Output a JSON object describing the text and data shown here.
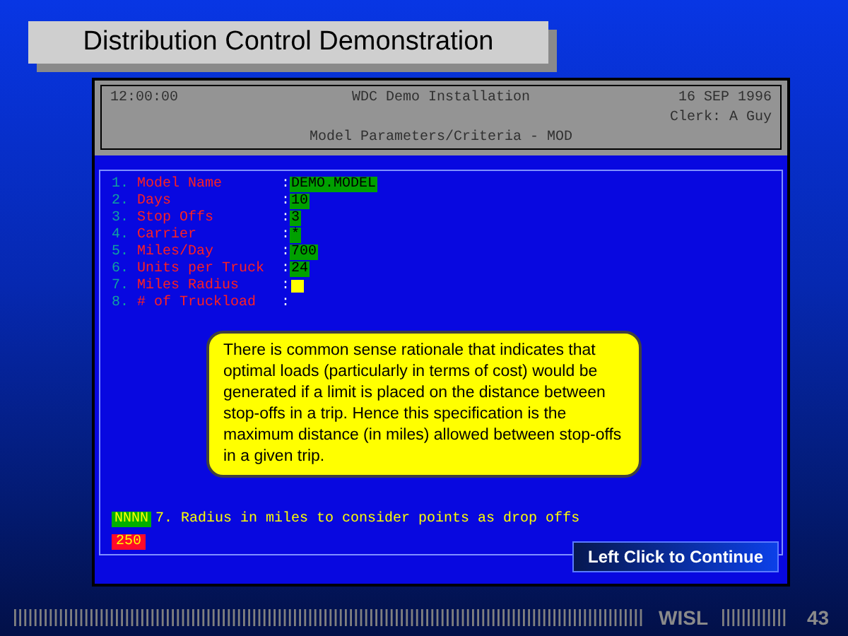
{
  "title": "Distribution Control Demonstration",
  "terminal": {
    "time": "12:00:00",
    "system": "WDC Demo Installation",
    "date": "16 SEP 1996",
    "clerk": "Clerk: A Guy",
    "screen": "Model Parameters/Criteria - MOD"
  },
  "fields": [
    {
      "number": "1.",
      "label": "Model Name",
      "separator": ":",
      "value": "DEMO.MODEL",
      "kind": "value"
    },
    {
      "number": "2.",
      "label": "Days",
      "separator": ":",
      "value": "10",
      "kind": "value"
    },
    {
      "number": "3.",
      "label": "Stop Offs",
      "separator": ":",
      "value": "3",
      "kind": "value"
    },
    {
      "number": "4.",
      "label": "Carrier",
      "separator": ":",
      "value": "*",
      "kind": "value"
    },
    {
      "number": "5.",
      "label": "Miles/Day",
      "separator": ":",
      "value": "700",
      "kind": "value"
    },
    {
      "number": "6.",
      "label": "Units per Truck",
      "separator": ":",
      "value": "24",
      "kind": "value"
    },
    {
      "number": "7.",
      "label": "Miles Radius",
      "separator": ":",
      "kind": "cursor"
    },
    {
      "number": "8.",
      "label": "# of Truckload",
      "separator": ":",
      "kind": "empty"
    }
  ],
  "callout": "There is common sense rationale that indicates that optimal loads (particularly in terms of cost) would be generated if a limit is placed on the distance between stop-offs in a trip. Hence this specification is the maximum distance (in miles) allowed between stop-offs in a given trip.",
  "help": {
    "format": "NNNN",
    "text": "7. Radius in miles to consider points as drop offs",
    "default": "250"
  },
  "continue_button": "Left Click to Continue",
  "footer": {
    "brand": "WISL",
    "page": "43"
  }
}
